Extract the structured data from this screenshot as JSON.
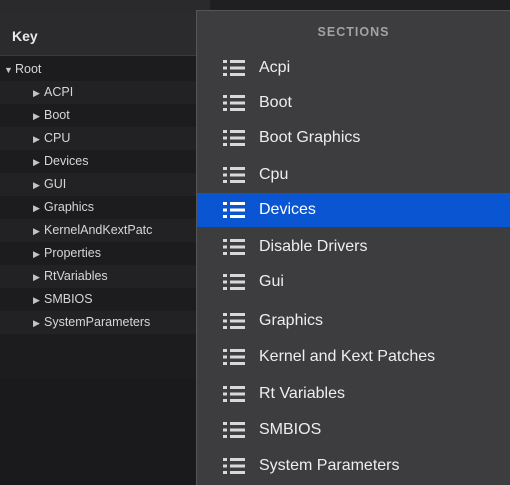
{
  "outline": {
    "header_key": "Key",
    "root_label": "Root",
    "items": [
      {
        "label": "ACPI"
      },
      {
        "label": "Boot"
      },
      {
        "label": "CPU"
      },
      {
        "label": "Devices"
      },
      {
        "label": "GUI"
      },
      {
        "label": "Graphics"
      },
      {
        "label": "KernelAndKextPatc"
      },
      {
        "label": "Properties"
      },
      {
        "label": "RtVariables"
      },
      {
        "label": "SMBIOS"
      },
      {
        "label": "SystemParameters"
      }
    ]
  },
  "menu": {
    "title": "SECTIONS",
    "selected_index": 4,
    "items": [
      {
        "label": "Acpi"
      },
      {
        "label": "Boot"
      },
      {
        "label": "Boot Graphics"
      },
      {
        "label": "Cpu"
      },
      {
        "label": "Devices"
      },
      {
        "label": "Disable Drivers"
      },
      {
        "label": "Gui"
      },
      {
        "label": "Graphics"
      },
      {
        "label": "Kernel and Kext Patches"
      },
      {
        "label": "Rt Variables"
      },
      {
        "label": "SMBIOS"
      },
      {
        "label": "System Parameters"
      }
    ],
    "icon": "list-icon",
    "selected_color": "#0a55d2"
  }
}
